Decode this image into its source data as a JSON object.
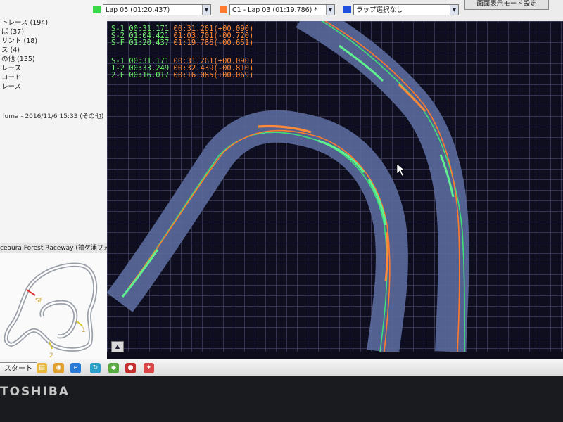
{
  "sidebar": {
    "items": [
      "トレース (194)",
      "ば (37)",
      "リント (18)",
      "ス (4)",
      "の他 (135)",
      "レース",
      "コード",
      "レース"
    ],
    "session": "luma - 2016/11/6 15:33 (その他)",
    "track_name": "ceaura Forest Raceway (袖ケ浦フォ",
    "minimap": {
      "sf_label": "SF",
      "label_1": "1",
      "label_2": "2"
    }
  },
  "toolbar": {
    "lap_a": "Lap 05  (01:20.437)",
    "lap_b": "C1 - Lap 03  (01:19.786) *",
    "lap_c": "ラップ選択なし",
    "display_mode": "画面表示モード設定",
    "colors": {
      "lap_a": "#39d94a",
      "lap_b": "#ff7a2e",
      "lap_c": "#2050e0"
    }
  },
  "times": {
    "rows": [
      {
        "label": "S-1",
        "base": "00:31.171",
        "compare": "00:31.261(+00.090)"
      },
      {
        "label": "S-2",
        "base": "01:04.421",
        "compare": "01:03.701(-00.720)"
      },
      {
        "label": "S-F",
        "base": "01:20.437",
        "compare": "01:19.786(-00.651)"
      },
      {
        "label": "S-1",
        "base": "00:31.171",
        "compare": "00:31.261(+00.090)"
      },
      {
        "label": "1-2",
        "base": "00:33.249",
        "compare": "00:32.439(-00.810)"
      },
      {
        "label": "2-F",
        "base": "00:16.017",
        "compare": "00:16.085(+00.069)"
      }
    ]
  },
  "taskbar": {
    "start_label": "スタート",
    "icons": [
      "folder-icon",
      "media-icon",
      "ie-icon",
      "refresh-icon",
      "app-icon",
      "satellite-icon"
    ]
  },
  "device_brand": "TOSHIBA"
}
